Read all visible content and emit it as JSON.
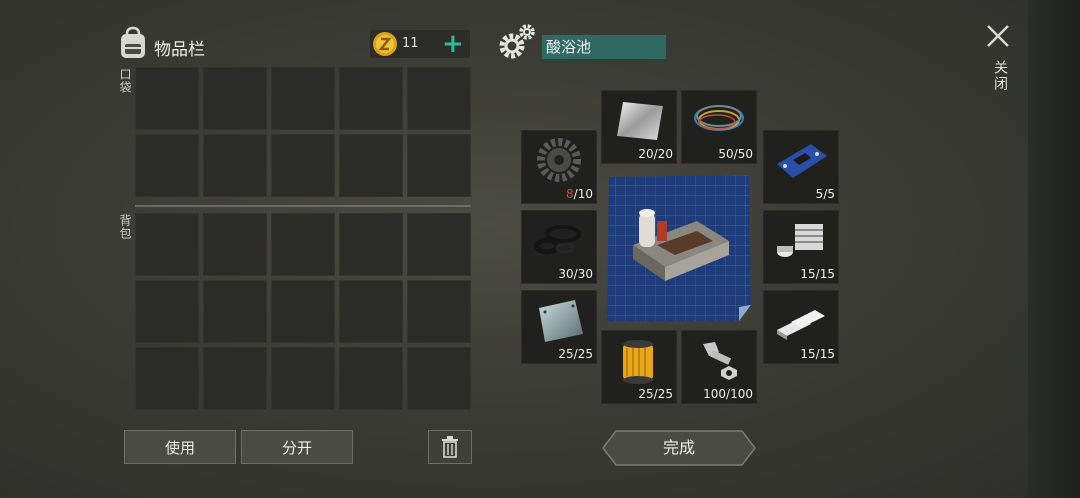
{
  "inventory": {
    "title": "物品栏",
    "coins": "11",
    "add_symbol": "+",
    "pocket_label": "口袋",
    "backpack_label": "背包",
    "use_label": "使用",
    "split_label": "分开"
  },
  "crafting": {
    "item_name": "酸浴池",
    "done_label": "完成",
    "parts": [
      {
        "icon": "metal-sheet-icon",
        "have": "20",
        "need": "20"
      },
      {
        "icon": "wires-icon",
        "have": "50",
        "need": "50"
      },
      {
        "icon": "gear-part-icon",
        "have": "8",
        "need": "10"
      },
      {
        "icon": "circuit-board-icon",
        "have": "5",
        "need": "5"
      },
      {
        "icon": "rubber-rings-icon",
        "have": "30",
        "need": "30"
      },
      {
        "icon": "engine-block-icon",
        "have": "15",
        "need": "15"
      },
      {
        "icon": "steel-plate-icon",
        "have": "25",
        "need": "25"
      },
      {
        "icon": "aluminum-bars-icon",
        "have": "15",
        "need": "15"
      },
      {
        "icon": "filter-icon",
        "have": "25",
        "need": "25"
      },
      {
        "icon": "bolts-icon",
        "have": "100",
        "need": "100"
      }
    ]
  },
  "close_label": "关闭",
  "colors": {
    "accent_teal": "#2e6a63",
    "plus_green": "#34b89a",
    "shortage_red": "#e04040"
  }
}
